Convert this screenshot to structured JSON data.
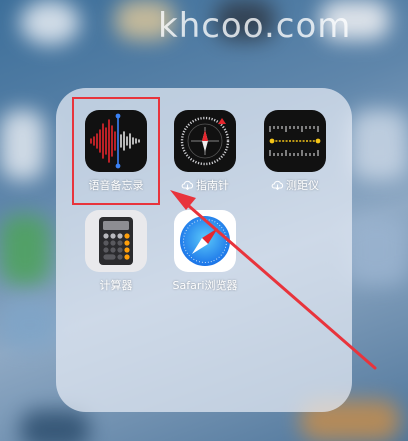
{
  "watermark": "khcoo.com",
  "folder": {
    "apps": [
      {
        "label": "语音备忘录",
        "icon": "voice-memos-icon",
        "cloud": false
      },
      {
        "label": "指南针",
        "icon": "compass-icon",
        "cloud": true
      },
      {
        "label": "测距仪",
        "icon": "measure-icon",
        "cloud": true
      },
      {
        "label": "计算器",
        "icon": "calculator-icon",
        "cloud": false
      },
      {
        "label": "Safari浏览器",
        "icon": "safari-icon",
        "cloud": false
      }
    ]
  },
  "annotation": {
    "color": "#e8343c"
  }
}
